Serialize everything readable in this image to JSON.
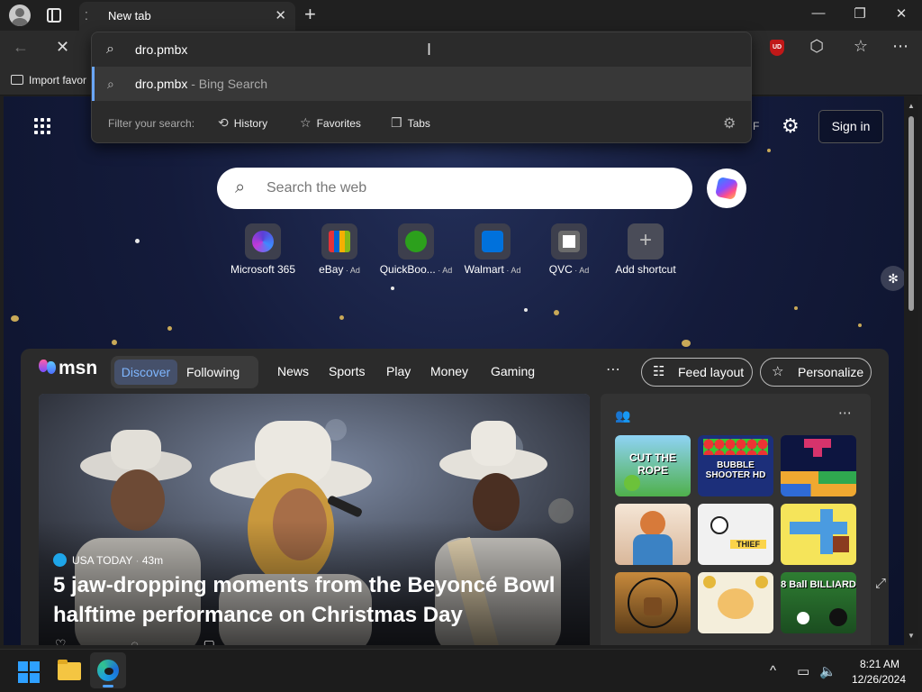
{
  "browser": {
    "tab_title": "New tab",
    "tab_loading_glyph": "⁚",
    "close_tab_glyph": "✕",
    "new_tab_glyph": "+",
    "window_controls": {
      "minimize": "—",
      "maximize": "❐",
      "close": "✕"
    },
    "nav": {
      "back": "←",
      "stop": "✕"
    },
    "extension_badge": "UD",
    "toolbar_icons": {
      "extensions": "⬡",
      "favorites": "☆",
      "more": "⋯"
    },
    "favorites_bar": {
      "import_label": "Import favor"
    }
  },
  "omnibox": {
    "query": "dro.pmbx",
    "caret": "I",
    "suggestion_query": "dro.pmbx",
    "suggestion_suffix": " - Bing Search",
    "filter_label": "Filter your search:",
    "filters": [
      {
        "label": "History",
        "icon": "history-icon",
        "glyph": "⟲"
      },
      {
        "label": "Favorites",
        "icon": "star-icon",
        "glyph": "☆"
      },
      {
        "label": "Tabs",
        "icon": "tabs-icon",
        "glyph": "❒"
      }
    ],
    "icons": {
      "search": "⌕",
      "settings": "⚙"
    }
  },
  "newtab": {
    "temp_fragment": "F",
    "settings_glyph": "⚙",
    "sign_in": "Sign in",
    "search_placeholder": "Search the web",
    "search_glyph": "⌕",
    "add_glyph": "+",
    "customize_glyph": "✻",
    "shortcuts": [
      {
        "label": "Microsoft 365",
        "ad": "",
        "color": "#5b3fd6"
      },
      {
        "label": "eBay",
        "ad": " · Ad",
        "color": "#e53238"
      },
      {
        "label": "QuickBoo...",
        "ad": " · Ad",
        "color": "#2ca01c"
      },
      {
        "label": "Walmart",
        "ad": " · Ad",
        "color": "#0071dc"
      },
      {
        "label": "QVC",
        "ad": " · Ad",
        "color": "#ffffff"
      },
      {
        "label": "Add shortcut",
        "ad": "",
        "color": ""
      }
    ]
  },
  "feed": {
    "brand": "msn",
    "tabs": {
      "discover": "Discover",
      "following": "Following"
    },
    "nav": [
      "News",
      "Sports",
      "Play",
      "Money",
      "Gaming"
    ],
    "more_glyph": "⋯",
    "feed_layout": "Feed layout",
    "personalize": "Personalize",
    "hero": {
      "source": "USA TODAY",
      "age": "43m",
      "headline": "5 jaw-dropping moments from the Beyoncé Bowl halftime performance on Christmas Day",
      "actions": "♡ ◌ ▢"
    },
    "games": {
      "more_glyph": "⋯",
      "icon_glyph": "👥",
      "expand_glyph": "⤢",
      "titles": [
        "CUT THE ROPE",
        "BUBBLE SHOOTER HD",
        "",
        "",
        "THIEF",
        "",
        "",
        "",
        "8 Ball BILLIARD"
      ]
    }
  },
  "taskbar": {
    "tray": {
      "chevron": "^",
      "display": "▭",
      "volume": "🔈"
    },
    "time": "8:21 AM",
    "date": "12/26/2024"
  },
  "colors": {
    "accent": "#6aa7ff",
    "page_bg": "#141b3b",
    "chrome": "#2b2b2b"
  }
}
